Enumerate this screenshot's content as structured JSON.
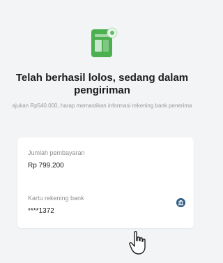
{
  "status": {
    "title": "Telah berhasil lolos, sedang dalam pengiriman",
    "subtitle": "ajukan Rp540.000, harap memastikan informasi rekening bank penerima"
  },
  "payment": {
    "amount_label": "Jumlah pembayaran",
    "amount_value": "Rp 799.200"
  },
  "bank": {
    "label": "Kartu rekening bank",
    "value": "****1372"
  },
  "colors": {
    "accent": "#4caf50",
    "bank_icon": "#2f5d86",
    "background": "#f3f4f6"
  },
  "icons": {
    "hero": "phone-check-icon",
    "bank": "bank-icon",
    "cursor": "hand-pointer-icon"
  }
}
